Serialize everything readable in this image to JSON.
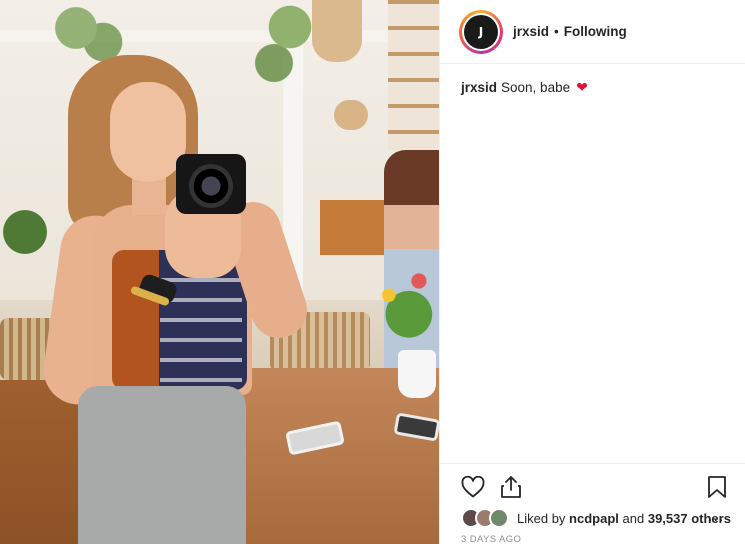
{
  "post": {
    "username": "jrxsid",
    "following_label": "Following",
    "separator": "•",
    "avatar_text": "J",
    "caption_user": "jrxsid",
    "caption_text": "Soon, babe",
    "caption_emoji": "❤",
    "liked_by_prefix": "Liked by",
    "liked_by_user": "ncdpapl",
    "liked_by_and": "and",
    "likes_count": "39,537 others",
    "timestamp": "3 DAYS AGO",
    "more": "..."
  },
  "icons": {
    "like": "heart-icon",
    "share": "share-icon",
    "save": "bookmark-icon"
  },
  "colors": {
    "text": "#262626",
    "muted": "#8e8e8e",
    "emoji_red": "#e0113a",
    "divider": "#efefef"
  }
}
